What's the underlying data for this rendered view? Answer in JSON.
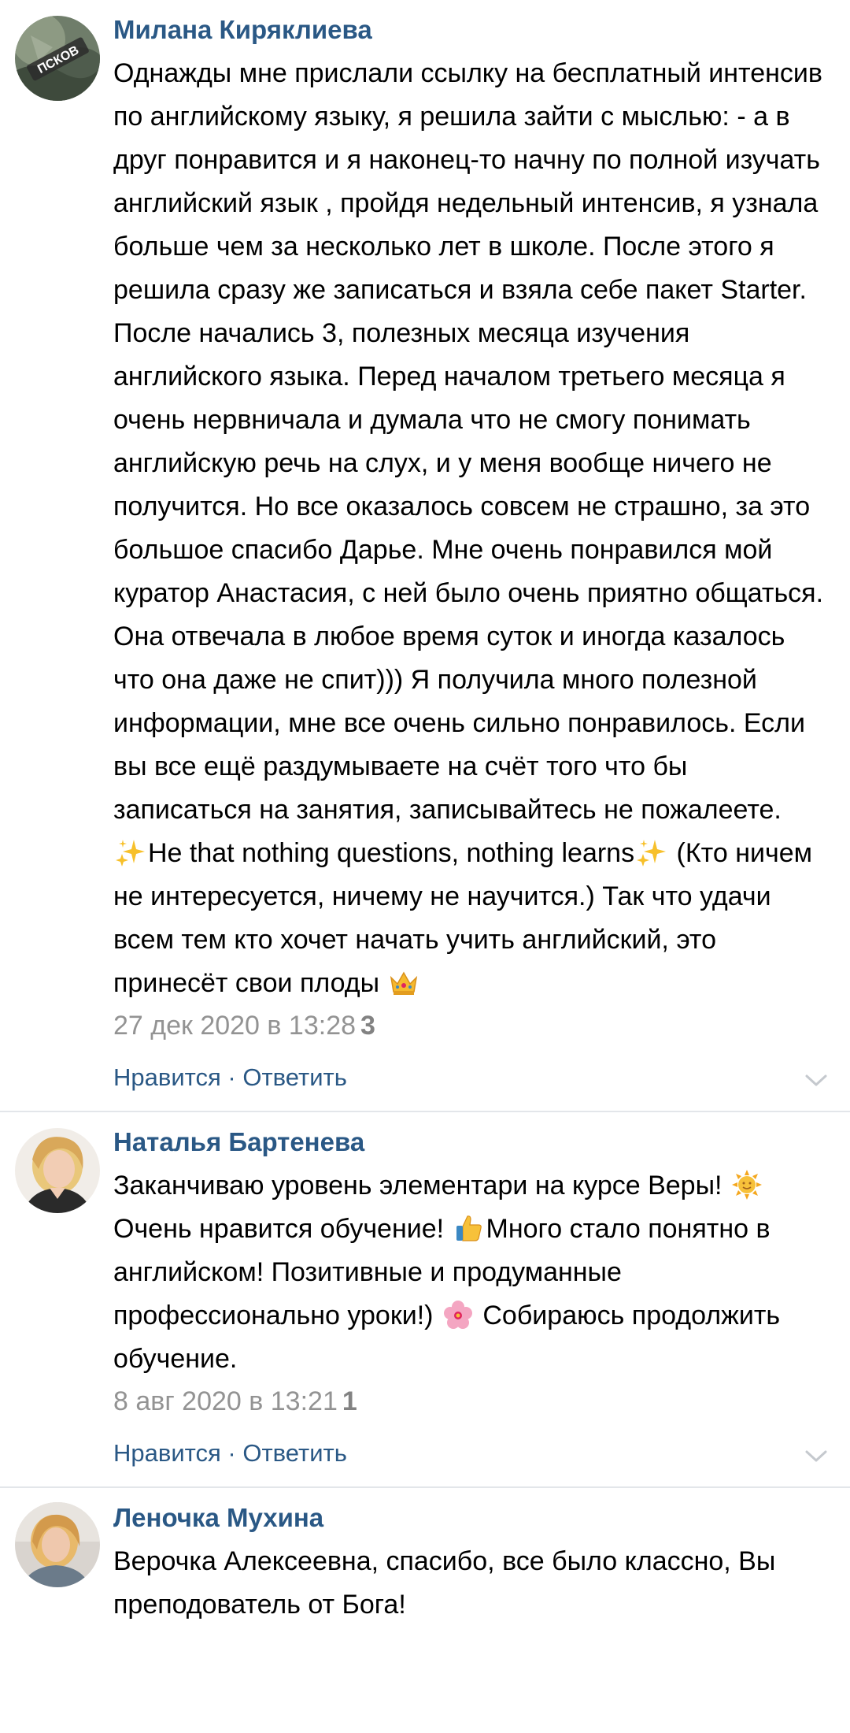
{
  "comments": [
    {
      "author": "Милана Киряклиева",
      "avatar_badge": "ПСКОВ",
      "paragraphs": [
        "Однажды мне прислали ссылку на бесплатный интенсив по английскому языку, я решила зайти с мыслью: - а в друг понравится и я наконец-то начну по полной изучать английский язык , пройдя недельный интенсив, я узнала больше чем за несколько лет в школе. После этого я решила сразу же записаться и взяла себе пакет Starter. После начались 3, полезных месяца изучения английского языка. Перед началом третьего месяца я очень нервничала и думала что не смогу понимать английскую речь на слух, и у меня вообще ничего не получится. Но все оказалось совсем не страшно, за это большое спасибо Дарье. Мне очень понравился мой куратор Анастасия, с ней было очень приятно общаться. Она отвечала в любое время суток и иногда казалось что она даже не спит))) Я получила много полезной информации, мне все очень сильно понравилось. Если вы все ещё раздумываете на счёт того что бы записаться на занятия, записывайтесь не пожалеете."
      ],
      "quote_text": "He that nothing questions, nothing learns",
      "after_quote": "(Кто ничем не интересуется, ничему не научится.) Так что удачи всем тем кто хочет начать учить английский, это принесёт свои плоды",
      "date": "27 дек 2020 в 13:28",
      "likes": "3",
      "like_label": "Нравится",
      "separator": " · ",
      "reply_label": "Ответить",
      "icons": [
        "sparkles-icon",
        "sparkles-icon",
        "crown-icon",
        "chevron-down-icon"
      ]
    },
    {
      "author": "Наталья Бартенева",
      "text_1": "Заканчиваю уровень элементари на курсе Веры!",
      "text_2": "Очень нравится обучение!",
      "text_3": "Много стало понятно в английском! Позитивные и продуманные профессионально уроки!)",
      "text_4": "Собираюсь продолжить обучение.",
      "date": "8 авг 2020 в 13:21",
      "likes": "1",
      "like_label": "Нравится",
      "separator": " · ",
      "reply_label": "Ответить",
      "icons": [
        "sun-face-icon",
        "thumbs-up-icon",
        "blossom-icon",
        "chevron-down-icon"
      ]
    },
    {
      "author": "Леночка Мухина",
      "text": "Верочка Алексеевна, спасибо, все было классно, Вы преподователь от Бога!"
    }
  ],
  "colors": {
    "author_link": "#2a5885",
    "meta_gray": "#939393",
    "divider": "#e3e6ea"
  }
}
